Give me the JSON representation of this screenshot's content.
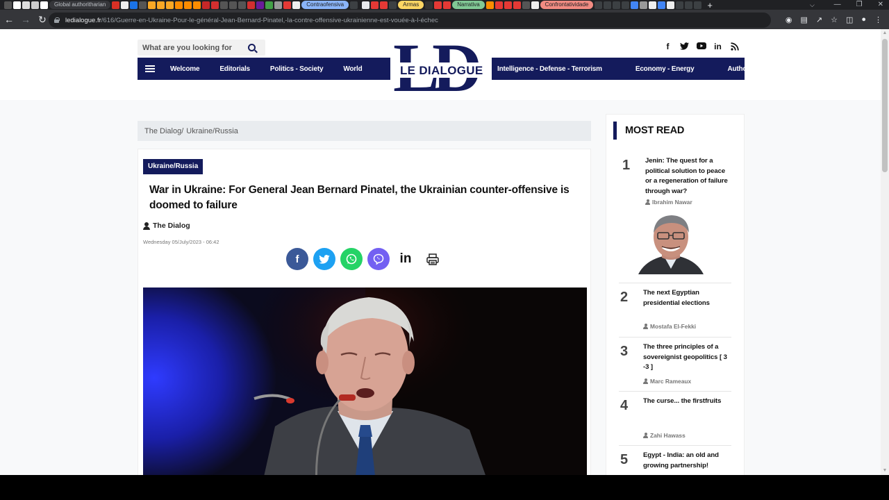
{
  "browser": {
    "tabs": [
      "Global authoritharian",
      "Contraofensiva",
      "Armas",
      "Narrativa",
      "Confrontatividade"
    ],
    "url_domain": "ledialogue.fr",
    "url_path": "/616/Guerre-en-Ukraine-Pour-le-général-Jean-Bernard-Pinatel,-la-contre-offensive-ukrainienne-est-vouée-à-l-échec"
  },
  "header": {
    "search_placeholder": "What are you looking for",
    "logo_text": "LE DIALOGUE",
    "logo_letters": "LD",
    "nav_left": [
      "Welcome",
      "Editorials",
      "Politics - Society",
      "World"
    ],
    "nav_right": [
      "Intelligence - Defense - Terrorism",
      "Economy - Energy",
      "Authors"
    ],
    "social_icons": [
      "facebook-icon",
      "twitter-icon",
      "youtube-icon",
      "linkedin-icon",
      "rss-icon"
    ]
  },
  "breadcrumb": {
    "home": "The Dialog/",
    "current": "Ukraine/Russia"
  },
  "article": {
    "category": "Ukraine/Russia",
    "title": "War in Ukraine: For General Jean Bernard Pinatel, the Ukrainian counter-offensive is doomed to failure",
    "author": "The Dialog",
    "date": "Wednesday 05/July/2023 - 06:42",
    "share": [
      "facebook",
      "twitter",
      "whatsapp",
      "viber",
      "linkedin",
      "print"
    ]
  },
  "sidebar": {
    "title": "MOST READ",
    "items": [
      {
        "num": "1",
        "title": "Jenin: The quest for a political solution to peace or a regeneration of failure through war?",
        "author": "Ibrahim Nawar"
      },
      {
        "num": "2",
        "title": "The next Egyptian presidential elections",
        "author": "Mostafa El-Fekki"
      },
      {
        "num": "3",
        "title": "The three principles of a sovereignist geopolitics [ 3 -3 ]",
        "author": "Marc Rameaux"
      },
      {
        "num": "4",
        "title": "The curse... the firstfruits",
        "author": "Zahi Hawass"
      },
      {
        "num": "5",
        "title": "Egypt - India: an old and growing partnership!",
        "author": ""
      }
    ]
  },
  "colors": {
    "brand_navy": "#141b5c",
    "facebook": "#3b5998",
    "twitter": "#1da1f2",
    "whatsapp": "#25d366",
    "viber": "#7360f2"
  }
}
